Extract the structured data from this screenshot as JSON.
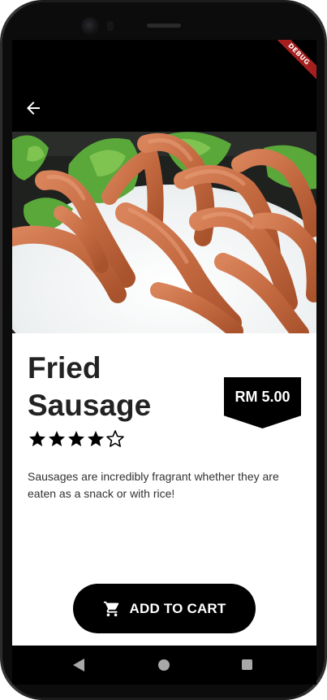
{
  "app": {
    "debug_label": "DEBUG"
  },
  "product": {
    "name": "Fried Sausage",
    "price": "RM 5.00",
    "rating": 4,
    "rating_max": 5,
    "description": "Sausages are incredibly fragrant whether they are eaten as a snack or with rice!"
  },
  "actions": {
    "add_to_cart_label": "ADD TO CART"
  },
  "icons": {
    "back": "arrow-back-icon",
    "cart": "shopping-cart-icon",
    "star_filled": "star-icon",
    "star_empty": "star-outline-icon",
    "nav_back": "nav-back-icon",
    "nav_home": "nav-home-icon",
    "nav_recents": "nav-recents-icon"
  },
  "colors": {
    "appbar": "#000000",
    "button": "#000000",
    "text": "#222222",
    "debug_ribbon": "#a51f1f"
  }
}
